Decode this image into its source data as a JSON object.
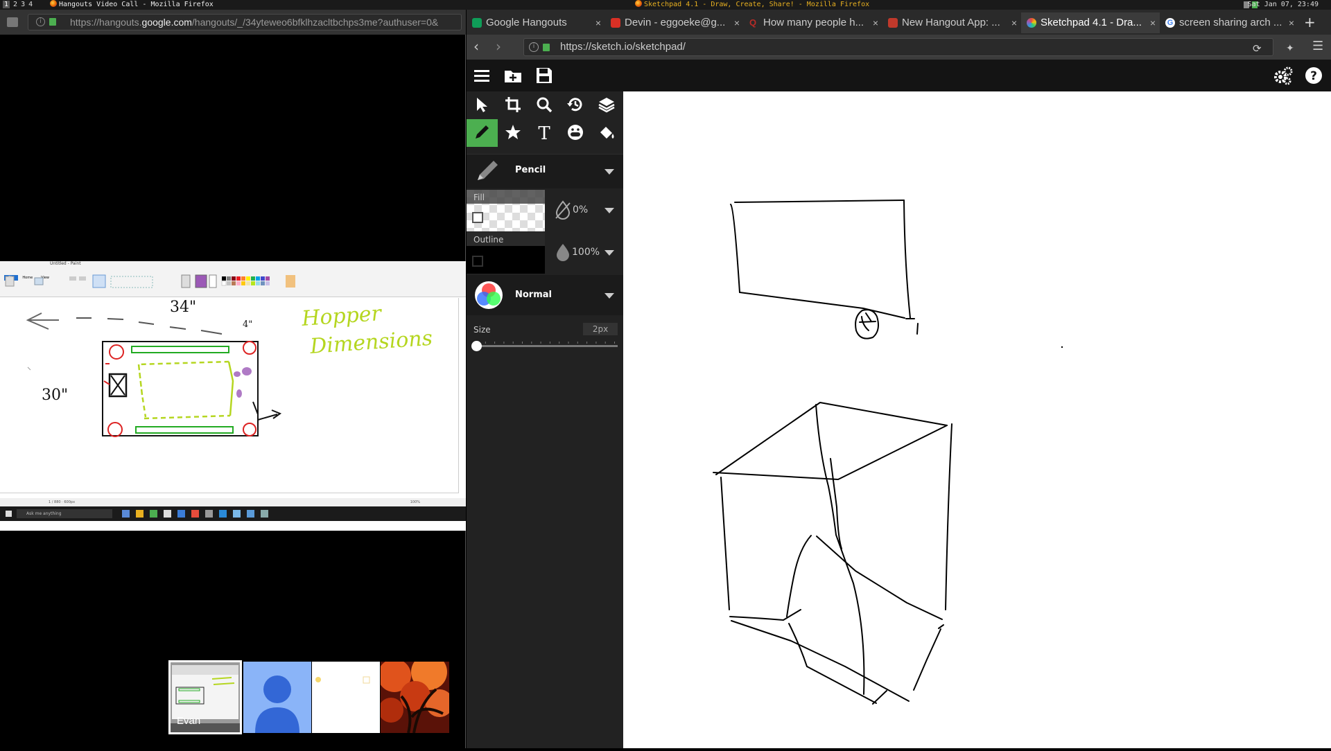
{
  "system_bar": {
    "workspaces": [
      "1",
      "2",
      "3",
      "4"
    ],
    "left_window_title": "Hangouts Video Call - Mozilla Firefox",
    "right_window_title": "Sketchpad 4.1 - Draw, Create, Share! - Mozilla Firefox",
    "clock": "Sat Jan 07, 23:49"
  },
  "hangouts_window": {
    "url_prefix": "https://hangouts.",
    "url_domain": "google.com",
    "url_suffix": "/hangouts/_/34yteweo6bfklhzacltbchps3me?authuser=0&",
    "shared_screen": {
      "window_title": "Untitled - Paint",
      "tabs": [
        "File",
        "Home",
        "View"
      ],
      "statusbar_text": "1 / 880 · 600px",
      "zoom": "100%",
      "taskbar_search": "Ask me anything",
      "drawing_labels": {
        "width": "34\"",
        "depth": "30\"",
        "small": "4\"",
        "title_line1": "Hopper",
        "title_line2": "Dimensions"
      }
    },
    "participants": [
      {
        "name": "Evan",
        "selected": true
      },
      {
        "name": "",
        "selected": false
      },
      {
        "name": "",
        "selected": false
      },
      {
        "name": "",
        "selected": false
      }
    ]
  },
  "sketchpad_window": {
    "tabs": [
      {
        "label": "Google Hangouts",
        "icon": "hangouts-icon",
        "color": "#0f9d58",
        "active": false
      },
      {
        "label": "Devin - eggoeke@g...",
        "icon": "gmail-icon",
        "color": "#d93025",
        "active": false
      },
      {
        "label": "How many people h...",
        "icon": "quora-icon",
        "color": "#b92b27",
        "active": false
      },
      {
        "label": "New Hangout App: ...",
        "icon": "page-icon",
        "color": "#c0392b",
        "active": false
      },
      {
        "label": "Sketchpad 4.1 - Dra...",
        "icon": "sketchpad-icon",
        "color": "#e74c3c",
        "active": true
      },
      {
        "label": "screen sharing arch ...",
        "icon": "google-icon",
        "color": "#4285f4",
        "active": false
      }
    ],
    "new_tab": "+",
    "url": "https://sketch.io/sketchpad/",
    "app": {
      "brush_name": "Pencil",
      "fill_label": "Fill",
      "fill_opacity": "0%",
      "outline_label": "Outline",
      "outline_opacity": "100%",
      "blend_mode": "Normal",
      "size_label": "Size",
      "size_value": "2px",
      "size_level": 0,
      "accent_color": "#4caf50"
    }
  }
}
